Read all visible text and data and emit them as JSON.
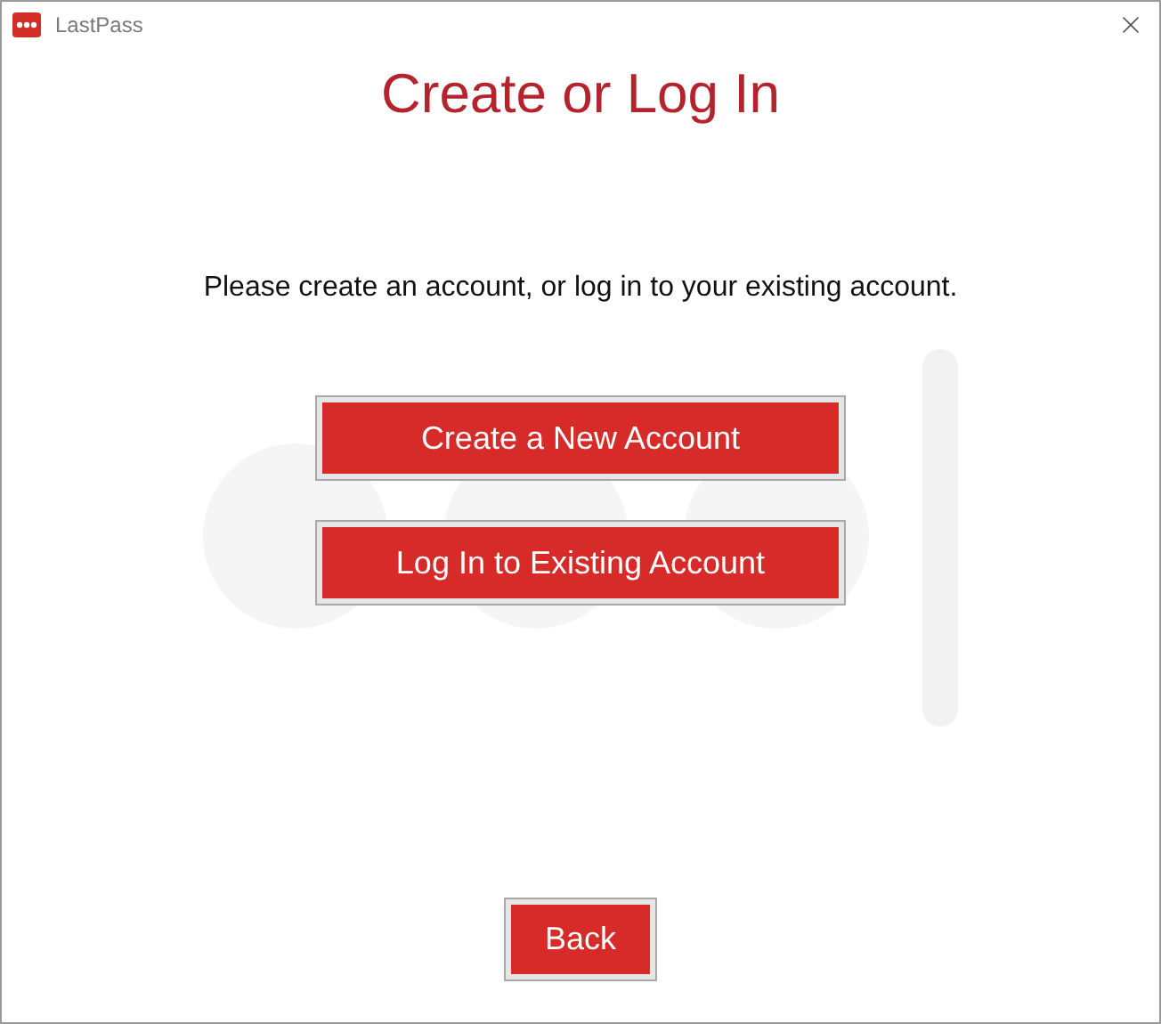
{
  "window": {
    "title": "LastPass"
  },
  "heading": "Create or Log In",
  "message": "Please create an account, or log in to your existing account.",
  "actions": [
    {
      "label": "Create a New Account"
    },
    {
      "label": "Log In to Existing Account"
    }
  ],
  "back_button": "Back"
}
